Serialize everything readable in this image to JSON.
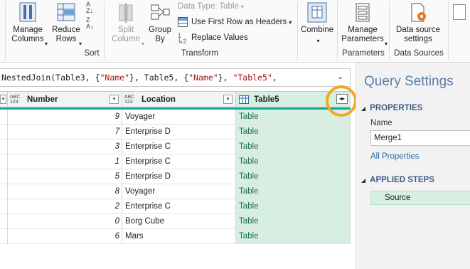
{
  "ribbon": {
    "manage_columns": "Manage\nColumns",
    "reduce_rows": "Reduce\nRows",
    "sort_label": "Sort",
    "split_column": "Split\nColumn",
    "group_by": "Group\nBy",
    "data_type": "Data Type: Table",
    "use_first_row": "Use First Row as Headers",
    "replace_values": "Replace Values",
    "transform_label": "Transform",
    "combine": "Combine",
    "manage_parameters": "Manage\nParameters",
    "parameters_label": "Parameters",
    "data_source_settings": "Data source\nsettings",
    "data_sources_label": "Data Sources"
  },
  "formula": {
    "prefix": "NestedJoin(Table3, {",
    "s1": "\"Name\"",
    "mid1": "}, Table5, {",
    "s2": "\"Name\"",
    "mid2": "}, ",
    "s3": "\"Table5\"",
    "suffix": ","
  },
  "grid": {
    "columns": [
      {
        "type": "ABC\n123",
        "name": "Number"
      },
      {
        "type": "ABC\n123",
        "name": "Location"
      },
      {
        "type": "table",
        "name": "Table5"
      }
    ],
    "rows": [
      {
        "number": "9",
        "location": "Voyager",
        "table": "Table"
      },
      {
        "number": "7",
        "location": "Enterprise D",
        "table": "Table"
      },
      {
        "number": "3",
        "location": "Enterprise C",
        "table": "Table"
      },
      {
        "number": "1",
        "location": "Enterprise C",
        "table": "Table"
      },
      {
        "number": "5",
        "location": "Enterprise D",
        "table": "Table"
      },
      {
        "number": "8",
        "location": "Voyager",
        "table": "Table"
      },
      {
        "number": "2",
        "location": "Enterprise C",
        "table": "Table"
      },
      {
        "number": "0",
        "location": "Borg Cube",
        "table": "Table"
      },
      {
        "number": "6",
        "location": "Mars",
        "table": "Table"
      }
    ]
  },
  "settings": {
    "title": "Query Settings",
    "properties": "PROPERTIES",
    "name_label": "Name",
    "name_value": "Merge1",
    "all_properties": "All Properties",
    "applied_steps": "APPLIED STEPS",
    "steps": [
      "Source"
    ]
  },
  "colors": {
    "accent_teal": "#16a99b",
    "selected_col": "#d7efe1",
    "highlight_ring": "#f5a623",
    "pane_title": "#5a7fa8"
  }
}
